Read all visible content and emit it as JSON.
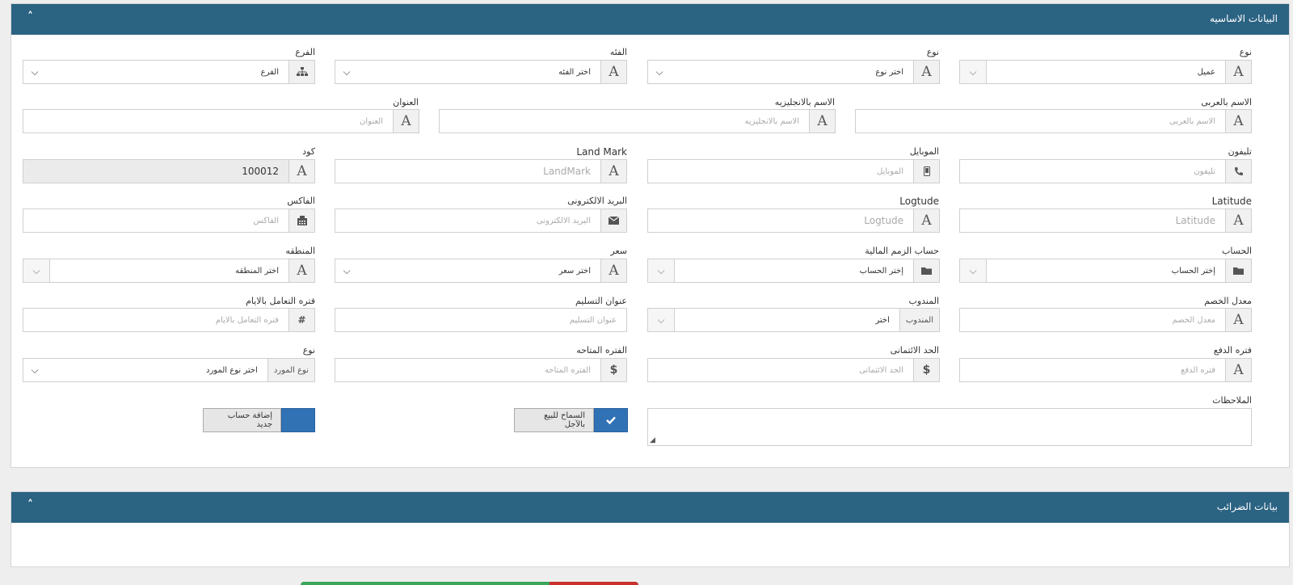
{
  "basic": {
    "title": "البيانات الاساسيه",
    "toggle": "˄"
  },
  "tax": {
    "title": "بيانات الضرائب",
    "toggle": "˄"
  },
  "rows": {
    "r1": {
      "type": {
        "label": "نوع",
        "value": "عميل"
      },
      "kind": {
        "label": "نوع",
        "placeholder": "اختر نوع"
      },
      "category": {
        "label": "الفئه",
        "placeholder": "اختر الفئه"
      },
      "branch": {
        "label": "الفرع",
        "placeholder": "الفرع"
      }
    },
    "r2": {
      "name_ar": {
        "label": "الاسم بالعربى",
        "placeholder": "الاسم بالعربى"
      },
      "name_en": {
        "label": "الاسم بالانجليزيه",
        "placeholder": "الاسم بالانجليزيه"
      },
      "address": {
        "label": "العنوان",
        "placeholder": "العنوان"
      }
    },
    "r3": {
      "phone": {
        "label": "تليفون",
        "placeholder": "تليفون"
      },
      "mobile": {
        "label": "الموبايل",
        "placeholder": "الموبايل"
      },
      "landmark": {
        "label": "Land Mark",
        "placeholder": "LandMark"
      },
      "code": {
        "label": "كود",
        "value": "100012"
      }
    },
    "r4": {
      "latitude": {
        "label": "Latitude",
        "placeholder": "Latitude"
      },
      "longitude": {
        "label": "Logtude",
        "placeholder": "Logtude"
      },
      "email": {
        "label": "البريد الالكترونى",
        "placeholder": "البريد الالكترونى"
      },
      "fax": {
        "label": "الفاكس",
        "placeholder": "الفاكس"
      }
    },
    "r5": {
      "account": {
        "label": "الحساب",
        "placeholder": "إختر الحساب"
      },
      "payables": {
        "label": "حساب الزمم المالية",
        "placeholder": "إختر الحساب"
      },
      "price": {
        "label": "سعر",
        "placeholder": "اختر سعر"
      },
      "region": {
        "label": "المنطقه",
        "placeholder": "اختر المنطقه"
      }
    },
    "r6": {
      "discount": {
        "label": "معدل الخصم",
        "placeholder": "معدل الخصم"
      },
      "rep": {
        "label": "المندوب",
        "addon": "المندوب",
        "value": "اختر"
      },
      "delivery": {
        "label": "عنوان التسليم",
        "placeholder": "عنوان التسليم"
      },
      "period_days": {
        "label": "فتره التعامل بالايام",
        "placeholder": "فتره التعامل بالايام"
      }
    },
    "r7": {
      "pay_period": {
        "label": "فتره الدفع",
        "placeholder": "فتره الدفع"
      },
      "credit_limit": {
        "label": "الحد الائتمانى",
        "placeholder": "الحد الائتمانى"
      },
      "available": {
        "label": "الفتره المتاحه",
        "placeholder": "الفتره المتاحه"
      },
      "supplier_type": {
        "label": "نوع",
        "addon": "نوع المورد",
        "value": "اختر نوع المورد"
      }
    }
  },
  "notes": {
    "label": "الملاحظات"
  },
  "buttons": {
    "allow_credit": "السماح للبيع بالآجل",
    "add_account": "إضافة حساب جديد"
  },
  "colors": {
    "header": "#2b6383",
    "button_blue": "#3172b5"
  }
}
